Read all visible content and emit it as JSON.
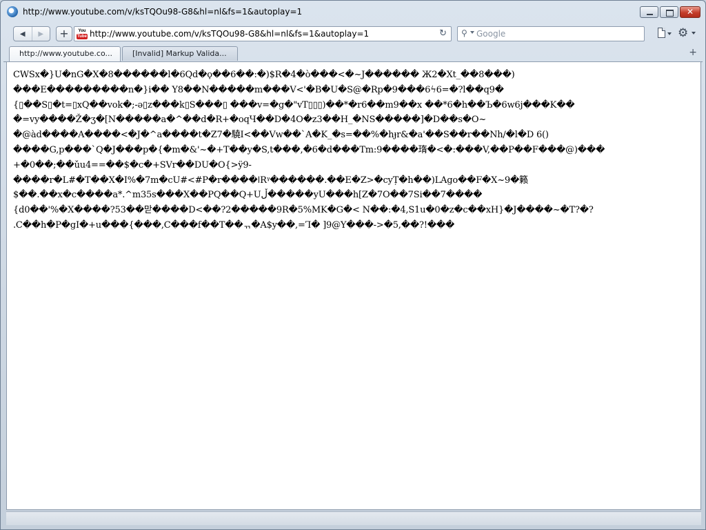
{
  "window": {
    "title": "http://www.youtube.com/v/ksTQOu98-G8&hl=nl&fs=1&autoplay=1",
    "buttons": {
      "minimize": "",
      "maximize": "",
      "close": "✕"
    }
  },
  "navbar": {
    "back_label": "◀",
    "forward_label": "▶",
    "new_tab_label": "+",
    "address": {
      "favicon_top": "You",
      "favicon_bottom": "Tube",
      "url": "http://www.youtube.com/v/ksTQOu98-G8&hl=nl&fs=1&autoplay=1",
      "reload_label": "↻"
    },
    "search": {
      "placeholder": "Google",
      "value": ""
    }
  },
  "tabs": [
    {
      "label": "http://www.youtube.co...",
      "active": true
    },
    {
      "label": "[Invalid] Markup Valida...",
      "active": false
    }
  ],
  "tab_add_label": "+",
  "content": {
    "lines": [
      "CWSx�}U�nG�X�8������l�6Qd�ϙ��6��:�)$R�4�ò���<�~J������ Ж2�Xt_��8���)",
      "���E���������n�}i�� Y8��N�����m���V<'�B�U�S@�Rp�9���6ϟ6=�?l��q9�",
      "{▯��S▯�t=▯xQ��vok�;-ə▯z���k▯S���▯ ���v=�g�\"vT▯▯▯)��*�r6��m9��x ��*6�h��Ъ�6w6j���K��",
      "�=vy����Ž�ʒ�[N�����a�^��d�R+�oqЧ��D�4O�z3��H_�NS�����]�D��s�O~",
      "�@àd����A����<�J�^a����t�Z7�驍I<��Vw��`A�K_�s=��%�hɟr&�a'��S��r��Nh/�l�D 6()",
      "����G,p���`Q�J���p�{�m�&'~�+T��y�S,t���,�6�d���Tm:9����㻟�<�:���V,��P��F���@)���",
      "+�0��;��ǔu4==��$�c�+SVr��DU�O{>ÿ9-",
      "����r�L#�T��X�I%�7m�cU#<#P�r����ǀRᵞ������.��E�Z>�cyȚ�h��)LAgo��F�X~9�籁",
      "$��.��x�c����a*.^m35s���X��PQ��Q+Uڵ�����yU���h[Z�7O��7Si��7����",
      "{d0��'%�X����?53��맏����D<��?2�����9R�5%MK�G�< N��:�4,S1u�0�z�c��xH}�J����~�T?�?",
      ".C��h�P�gI�+u���{���,C���f��T��ᆩ�A$y��,=Ꞁ� ]9@Y���->�5,��?!���"
    ]
  },
  "statusbar": {
    "text": ""
  }
}
